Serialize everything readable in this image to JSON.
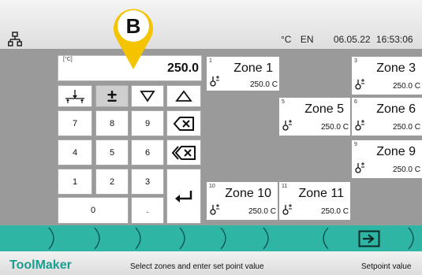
{
  "marker": {
    "letter": "B",
    "color": "#f5c400"
  },
  "header": {
    "unit": "°C",
    "language": "EN",
    "date": "06.05.22",
    "time": "16:53:06"
  },
  "keypad": {
    "unit_label": "[°C]",
    "value": "250.0",
    "keys": [
      "7",
      "8",
      "9",
      "4",
      "5",
      "6",
      "1",
      "2",
      "3",
      "0",
      "."
    ],
    "icons": [
      "link-values-icon",
      "plus-minus-icon",
      "arrow-down-icon",
      "arrow-up-icon",
      "backspace-icon",
      "clear-icon",
      "enter-icon"
    ],
    "plus_minus_symbol": "±"
  },
  "zones": [
    {
      "num": "1",
      "name": "Zone 1",
      "temp": "250.0 C"
    },
    {
      "num": "3",
      "name": "Zone 3",
      "temp": "250.0 C"
    },
    {
      "num": "5",
      "name": "Zone 5",
      "temp": "250.0 C"
    },
    {
      "num": "6",
      "name": "Zone 6",
      "temp": "250.0 C"
    },
    {
      "num": "9",
      "name": "Zone 9",
      "temp": "250.0 C"
    },
    {
      "num": "10",
      "name": "Zone 10",
      "temp": "250.0 C"
    },
    {
      "num": "11",
      "name": "Zone 11",
      "temp": "250.0 C"
    }
  ],
  "footer": {
    "brand": "ToolMaker",
    "hint": "Select zones and enter set point value",
    "mode": "Setpoint value"
  },
  "colors": {
    "accent": "#2fb5a4",
    "brand": "#1a9e8f",
    "panel": "#9a9a9a",
    "marker": "#f5c400"
  }
}
